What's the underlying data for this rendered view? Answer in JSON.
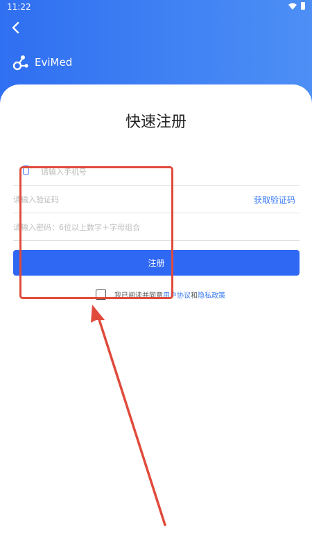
{
  "status_bar": {
    "time": "11:22"
  },
  "brand": {
    "name": "EviMed"
  },
  "page": {
    "title": "快速注册"
  },
  "form": {
    "phone_placeholder": "请输入手机号",
    "code_placeholder": "请输入验证码",
    "get_code_label": "获取验证码",
    "password_placeholder": "请输入密码：6位以上数字＋字母组合",
    "register_label": "注册"
  },
  "agreement": {
    "prefix": "我已阅读并同意",
    "user_agreement": "用户协议",
    "conjunction": "和",
    "privacy_policy": "隐私政策"
  },
  "colors": {
    "header_gradient_start": "#2f6ff1",
    "header_gradient_end": "#4d8ff5",
    "primary_button": "#2f68f2",
    "link": "#3a7bf3",
    "annotation": "#e04a3b"
  },
  "icons": [
    "back-arrow-icon",
    "wifi-icon",
    "battery-icon",
    "evimed-logo-icon",
    "phone-icon",
    "checkbox-icon"
  ]
}
